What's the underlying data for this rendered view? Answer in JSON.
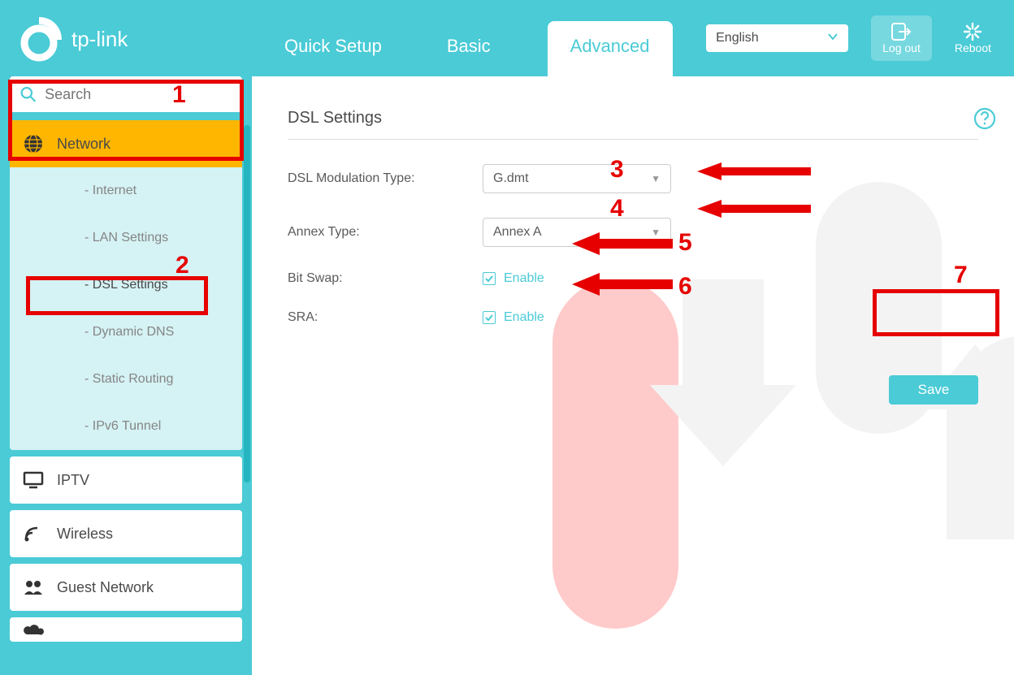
{
  "brand": "tp-link",
  "header": {
    "tabs": {
      "quick_setup": "Quick Setup",
      "basic": "Basic",
      "advanced": "Advanced"
    },
    "language": "English",
    "logout": "Log out",
    "reboot": "Reboot"
  },
  "sidebar": {
    "search_placeholder": "Search",
    "network": {
      "label": "Network",
      "items": [
        "- Internet",
        "- LAN Settings",
        "- DSL Settings",
        "- Dynamic DNS",
        "- Static Routing",
        "- IPv6 Tunnel"
      ],
      "active_index": 2
    },
    "iptv": "IPTV",
    "wireless": "Wireless",
    "guest_network": "Guest Network"
  },
  "page": {
    "title": "DSL Settings",
    "dsl_modulation_label": "DSL Modulation Type:",
    "dsl_modulation_value": "G.dmt",
    "annex_label": "Annex Type:",
    "annex_value": "Annex A",
    "bitswap_label": "Bit Swap:",
    "bitswap_enable": "Enable",
    "sra_label": "SRA:",
    "sra_enable": "Enable",
    "save": "Save"
  },
  "annotations": {
    "n1": "1",
    "n2": "2",
    "n3": "3",
    "n4": "4",
    "n5": "5",
    "n6": "6",
    "n7": "7"
  }
}
